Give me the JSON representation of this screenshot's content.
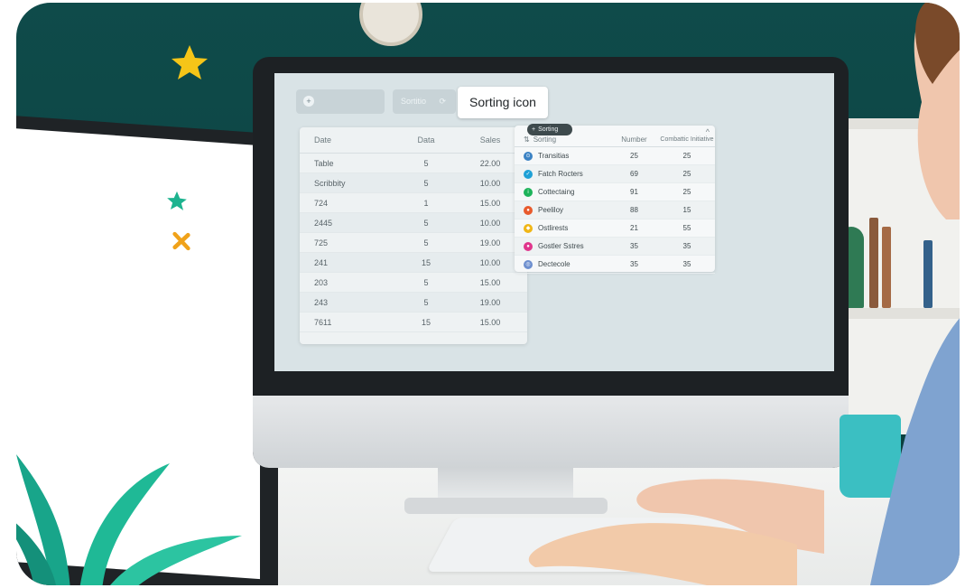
{
  "toolbar": {
    "search_placeholder": "",
    "sort_button_label": "Sortitio",
    "sort_button_glyph": "⟳",
    "tooltip": "Sorting icon"
  },
  "left_table": {
    "headers": [
      "Date",
      "Data",
      "Sales"
    ],
    "rows": [
      [
        "Table",
        "5",
        "22.00"
      ],
      [
        "Scribbity",
        "5",
        "10.00"
      ],
      [
        "724",
        "1",
        "15.00"
      ],
      [
        "2445",
        "5",
        "10.00"
      ],
      [
        "725",
        "5",
        "19.00"
      ],
      [
        "241",
        "15",
        "10.00"
      ],
      [
        "203",
        "5",
        "15.00"
      ],
      [
        "243",
        "5",
        "19.00"
      ],
      [
        "7611",
        "15",
        "15.00"
      ]
    ]
  },
  "sort_chip": {
    "icon": "sort-icon",
    "label": "Sorting"
  },
  "right_table": {
    "headers": [
      "Sorting",
      "Number",
      "Combattic Initiative"
    ],
    "rows": [
      {
        "icon_color": "#3b82c4",
        "label": "Transitias",
        "number": "25",
        "value": "25"
      },
      {
        "icon_color": "#1ea0d6",
        "label": "Fatch Rocters",
        "number": "69",
        "value": "25"
      },
      {
        "icon_color": "#1db35a",
        "label": "Cottectaing",
        "number": "91",
        "value": "25"
      },
      {
        "icon_color": "#e85a2c",
        "label": "Peeliloy",
        "number": "88",
        "value": "15"
      },
      {
        "icon_color": "#f0b616",
        "label": "Ostlirests",
        "number": "21",
        "value": "55"
      },
      {
        "icon_color": "#e0358c",
        "label": "Gostler Sstres",
        "number": "35",
        "value": "35"
      },
      {
        "icon_color": "#6d8fcf",
        "label": "Dectecole",
        "number": "35",
        "value": "35"
      }
    ]
  },
  "colors": {
    "wall": "#0f4b4a",
    "screen_bg": "#d9e3e6",
    "accent_star": "#f5c518",
    "teal_star": "#1db38f",
    "orange_star": "#f0a21a"
  }
}
